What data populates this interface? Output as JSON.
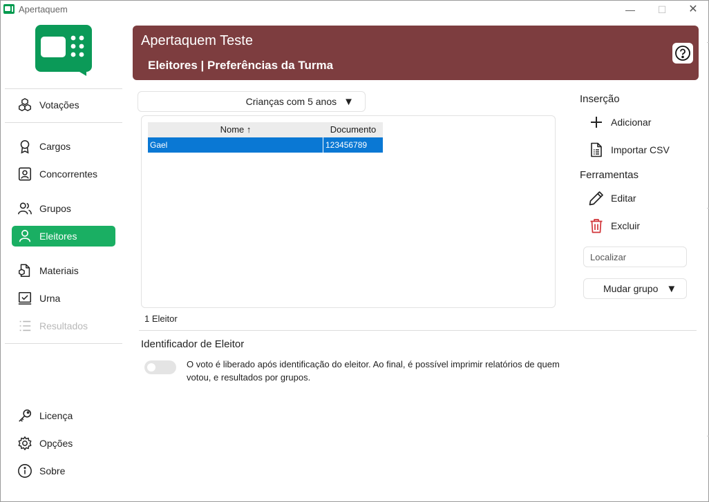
{
  "window": {
    "title": "Apertaquem",
    "minimize": "—",
    "maximize": "☐",
    "close": "✕"
  },
  "sidebar": {
    "items": [
      {
        "label": "Votações",
        "icon": "cubes-icon"
      },
      {
        "label": "Cargos",
        "icon": "award-icon"
      },
      {
        "label": "Concorrentes",
        "icon": "contact-card-icon"
      },
      {
        "label": "Grupos",
        "icon": "people-icon"
      },
      {
        "label": "Eleitores",
        "icon": "person-icon",
        "active": true
      },
      {
        "label": "Materiais",
        "icon": "document-cube-icon"
      },
      {
        "label": "Urna",
        "icon": "ballot-box-icon"
      },
      {
        "label": "Resultados",
        "icon": "list-icon",
        "disabled": true
      },
      {
        "label": "Licença",
        "icon": "key-icon"
      },
      {
        "label": "Opções",
        "icon": "gear-icon"
      },
      {
        "label": "Sobre",
        "icon": "info-icon"
      }
    ]
  },
  "header": {
    "title": "Apertaquem Teste",
    "subtitle": "Eleitores | Preferências da Turma"
  },
  "group_selector": {
    "value": "Crianças com 5 anos"
  },
  "table": {
    "columns": [
      "Nome ↑",
      "Documento"
    ],
    "rows": [
      {
        "name": "Gael",
        "document": "123456789"
      }
    ],
    "count_label": "1 Eleitor"
  },
  "tools": {
    "insert_title": "Inserção",
    "add": "Adicionar",
    "import_csv": "Importar CSV",
    "tools_title": "Ferramentas",
    "edit": "Editar",
    "delete": "Excluir",
    "search_placeholder": "Localizar",
    "change_group": "Mudar grupo"
  },
  "identifier": {
    "title": "Identificador de Eleitor",
    "enabled": false,
    "description": "O voto é liberado após identificação do eleitor. Ao final, é possível imprimir relatórios de quem votou, e resultados por grupos."
  },
  "colors": {
    "accent": "#1aaf63",
    "header": "#7d3d3f",
    "selection": "#0a78d4",
    "danger": "#d13438"
  }
}
